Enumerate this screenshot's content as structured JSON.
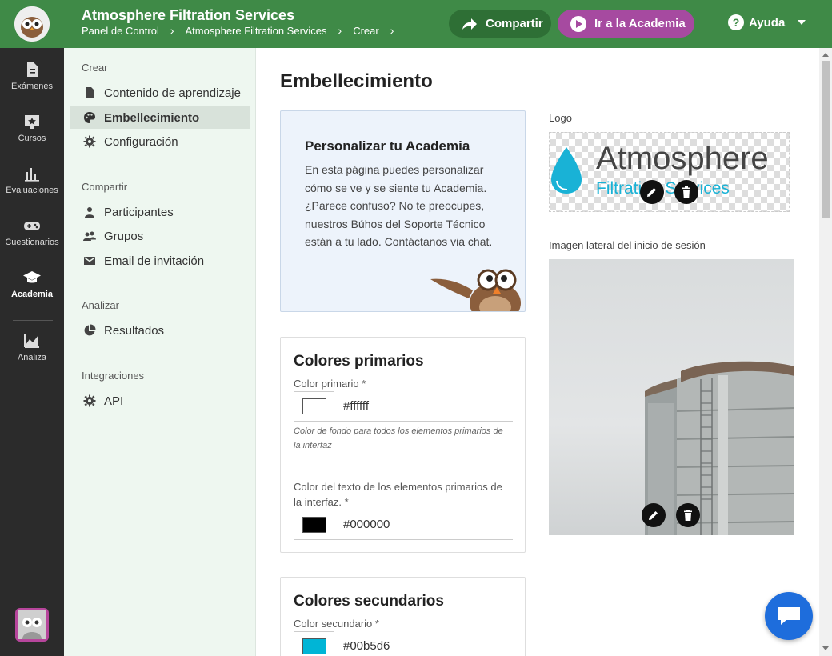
{
  "header": {
    "title": "Atmosphere Filtration Services",
    "breadcrumbs": [
      "Panel de Control",
      "Atmosphere Filtration Services",
      "Crear"
    ],
    "share_label": "Compartir",
    "academy_label": "Ir a la Academia",
    "help_label": "Ayuda",
    "icons": [
      "owl-logo",
      "share-arrow-icon",
      "play-icon",
      "help-icon",
      "chevron-down-icon"
    ]
  },
  "rail": {
    "items": [
      {
        "label": "Exámenes",
        "icon": "document-icon"
      },
      {
        "label": "Cursos",
        "icon": "course-icon"
      },
      {
        "label": "Evaluaciones",
        "icon": "bar-chart-icon"
      },
      {
        "label": "Cuestionarios",
        "icon": "gamepad-icon"
      },
      {
        "label": "Academia",
        "icon": "graduation-cap-icon"
      },
      {
        "label": "Analiza",
        "icon": "line-chart-icon"
      }
    ]
  },
  "subnav": {
    "sections": [
      {
        "title": "Crear",
        "items": [
          {
            "label": "Contenido de aprendizaje",
            "icon": "file-icon"
          },
          {
            "label": "Embellecimiento",
            "icon": "palette-icon"
          },
          {
            "label": "Configuración",
            "icon": "gear-icon"
          }
        ]
      },
      {
        "title": "Compartir",
        "items": [
          {
            "label": "Participantes",
            "icon": "person-icon"
          },
          {
            "label": "Grupos",
            "icon": "group-icon"
          },
          {
            "label": "Email de invitación",
            "icon": "mail-icon"
          }
        ]
      },
      {
        "title": "Analizar",
        "items": [
          {
            "label": "Resultados",
            "icon": "pie-chart-icon"
          }
        ]
      },
      {
        "title": "Integraciones",
        "items": [
          {
            "label": "API",
            "icon": "gear-icon"
          }
        ]
      }
    ]
  },
  "main": {
    "title": "Embellecimiento",
    "intro": {
      "title": "Personalizar tu Academia",
      "text": "En esta página puedes personalizar cómo se ve y se siente tu Academia. ¿Parece confuso? No te preocupes, nuestros Búhos del Soporte Técnico están a tu lado. Contáctanos via chat."
    },
    "primary": {
      "title": "Colores primarios",
      "color_label": "Color primario *",
      "color_value": "#ffffff",
      "color_helper": "Color de fondo para todos los elementos primarios de la interfaz",
      "text_label": "Color del texto de los elementos primarios de la interfaz. *",
      "text_value": "#000000"
    },
    "secondary": {
      "title": "Colores secundarios",
      "color_label": "Color secundario *",
      "color_value": "#00b5d6"
    },
    "logo": {
      "label": "Logo",
      "word": "Atmosphere",
      "sub": "Filtration Services"
    },
    "side_image": {
      "label": "Imagen lateral del inicio de sesión"
    }
  },
  "colors": {
    "header_green": "#3f8a47",
    "academy_purple": "#a64aa0",
    "rail_dark": "#2b2b2b",
    "chat_blue": "#1e6ddc",
    "accent_cyan": "#00b5d6"
  }
}
